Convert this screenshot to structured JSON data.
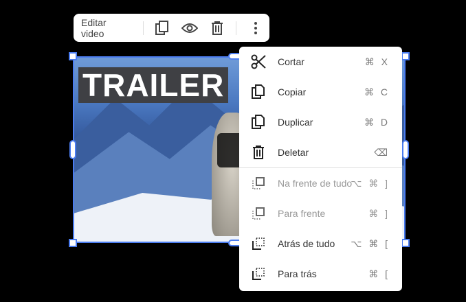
{
  "toolbar": {
    "edit_label": "Editar video",
    "icons": [
      "copy-icon",
      "eye-icon",
      "trash-icon",
      "more-vert-icon"
    ]
  },
  "video": {
    "title_overlay": "TRAILER"
  },
  "menu": {
    "items": [
      {
        "label": "Cortar",
        "shortcut": "⌘ X",
        "icon": "scissors-icon",
        "enabled": true
      },
      {
        "label": "Copiar",
        "shortcut": "⌘ C",
        "icon": "copy-icon",
        "enabled": true
      },
      {
        "label": "Duplicar",
        "shortcut": "⌘ D",
        "icon": "duplicate-icon",
        "enabled": true
      },
      {
        "label": "Deletar",
        "shortcut": "⌫",
        "icon": "trash-icon",
        "enabled": true
      },
      {
        "label": "Na frente de tudo",
        "shortcut": "⌥ ⌘ ]",
        "icon": "bring-to-front-icon",
        "enabled": false
      },
      {
        "label": "Para frente",
        "shortcut": "⌘ ]",
        "icon": "bring-forward-icon",
        "enabled": false
      },
      {
        "label": "Atrás de tudo",
        "shortcut": "⌥ ⌘ [",
        "icon": "send-to-back-icon",
        "enabled": true
      },
      {
        "label": "Para trás",
        "shortcut": "⌘ [",
        "icon": "send-backward-icon",
        "enabled": true
      }
    ]
  },
  "colors": {
    "selection": "#4a7cf0",
    "background": "#000000"
  }
}
